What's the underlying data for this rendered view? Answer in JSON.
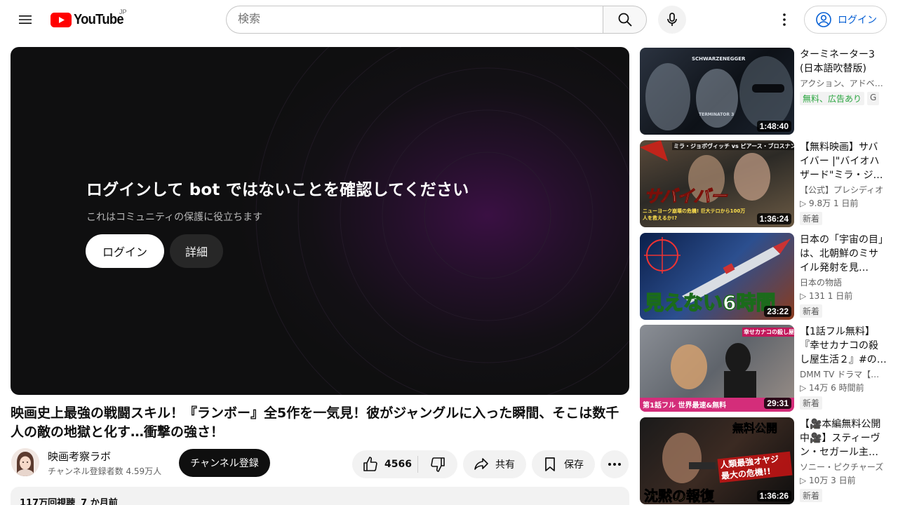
{
  "header": {
    "logo_text": "YouTube",
    "country_code": "JP",
    "search_placeholder": "検索",
    "login_label": "ログイン"
  },
  "player": {
    "gate_title": "ログインして bot ではないことを確認してください",
    "gate_subtitle": "これはコミュニティの保護に役立ちます",
    "login_button": "ログイン",
    "details_button": "詳細"
  },
  "video": {
    "title": "映画史上最強の戦闘スキル！『ランボー』全5作を一気見！彼がジャングルに入った瞬間、そこは数千人の敵の地獄と化す…衝撃の強さ！",
    "channel_name": "映画考察ラボ",
    "channel_subs": "チャンネル登録者数 4.59万人",
    "subscribe_label": "チャンネル登録",
    "like_count": "4566",
    "share_label": "共有",
    "save_label": "保存",
    "views": "117万回視聴",
    "published": "7 か月前"
  },
  "recommendations": [
    {
      "title": "ターミネーター3 (日本語吹替版)",
      "channel": "アクション、アドベンチャー",
      "stats": "",
      "badges": [
        "無料、広告あり",
        "G"
      ],
      "duration": "1:48:40",
      "thumb_text": "SCHWARZENEGGER",
      "thumb_subtext": "TERMINATOR 3"
    },
    {
      "title": "【無料映画】サバイバー |\"バイオハザード\"ミラ・ジョヴォヴィッチ",
      "channel": "【公式】プレシディオ",
      "stats": "▷ 9.8万  1 日前",
      "badges": [
        "新着"
      ],
      "duration": "1:36:24",
      "thumb_text": "ミラ・ジョボヴィッチ vs ピアース・ブロスナン",
      "thumb_big": "サバイバー",
      "thumb_caption": "ニューヨーク崩壊の危機! 巨大テロから100万人を救えるか!?"
    },
    {
      "title": "日本の「宇宙の目」は、北朝鮮のミサイル発射を見…",
      "channel": "日本の物語",
      "stats": "▷ 131  1 日前",
      "badges": [
        "新着"
      ],
      "duration": "23:22",
      "thumb_big": "見えない6時間"
    },
    {
      "title": "【1話フル無料】『幸せカナコの殺し屋生活２』#の…",
      "channel": "DMM TV ドラマ【公式】",
      "stats": "▷ 14万  6 時間前",
      "badges": [
        "新着"
      ],
      "duration": "29:31",
      "thumb_text": "幸せカナコの殺し屋生活2",
      "thumb_caption": "第1話フル 世界最速&無料"
    },
    {
      "title": "【🎥本編無料公開中🎥】スティーヴン・セガール主演…",
      "channel": "ソニー・ピクチャーズ",
      "stats": "▷ 10万  3 日前",
      "badges": [
        "新着"
      ],
      "duration": "1:36:26",
      "thumb_text": "無料公開",
      "thumb_big": "沈黙の報復",
      "thumb_caption": "人類最強オヤジ 最大の危機!!"
    }
  ]
}
